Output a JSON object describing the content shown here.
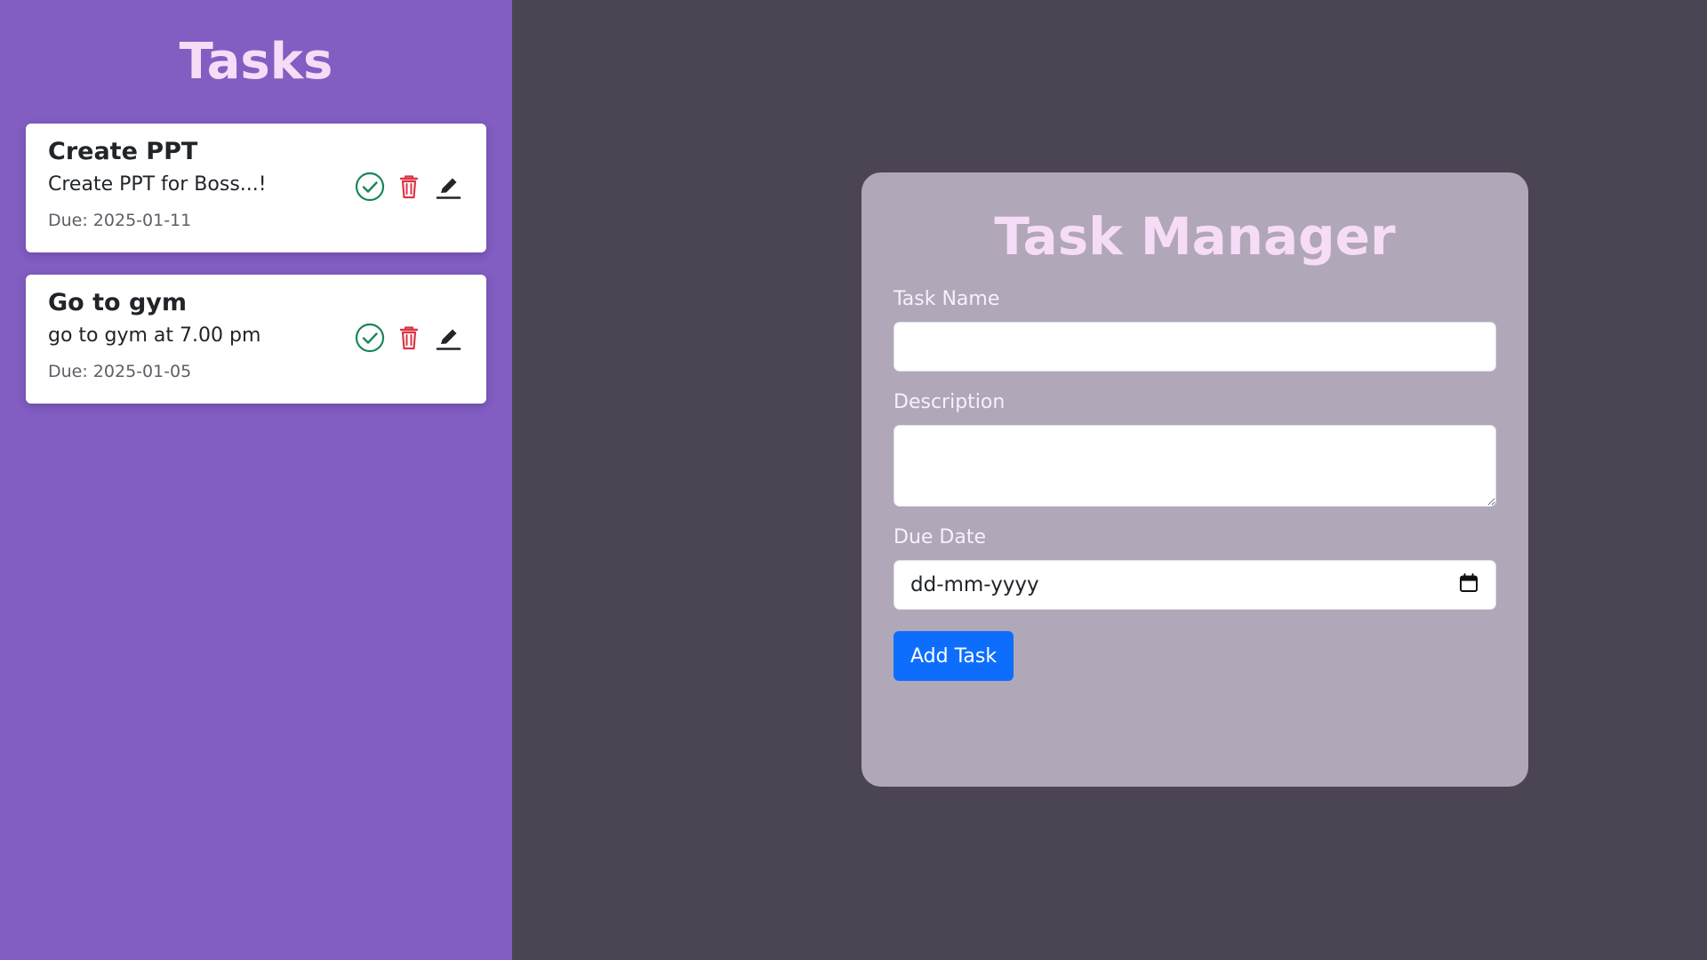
{
  "sidebar": {
    "title": "Tasks",
    "tasks": [
      {
        "name": "Create PPT",
        "description": "Create PPT for Boss...!",
        "due": "Due: 2025-01-11"
      },
      {
        "name": "Go to gym",
        "description": "go to gym at 7.00 pm",
        "due": "Due: 2025-01-05"
      }
    ],
    "icons": {
      "complete": "check-circle-icon",
      "delete": "trash-icon",
      "edit": "pencil-icon"
    }
  },
  "form": {
    "title": "Task Manager",
    "task_name_label": "Task Name",
    "task_name_value": "",
    "description_label": "Description",
    "description_value": "",
    "due_date_label": "Due Date",
    "due_date_placeholder": "dd-mm-yyyy",
    "submit_label": "Add Task"
  },
  "colors": {
    "sidebar_bg": "#825ec2",
    "page_bg": "#4b4553",
    "card_bg": "#b0a7b8",
    "title_color": "#f6dcf6",
    "primary_button": "#0d6efd",
    "complete_icon": "#198754",
    "delete_icon": "#dc3545"
  }
}
